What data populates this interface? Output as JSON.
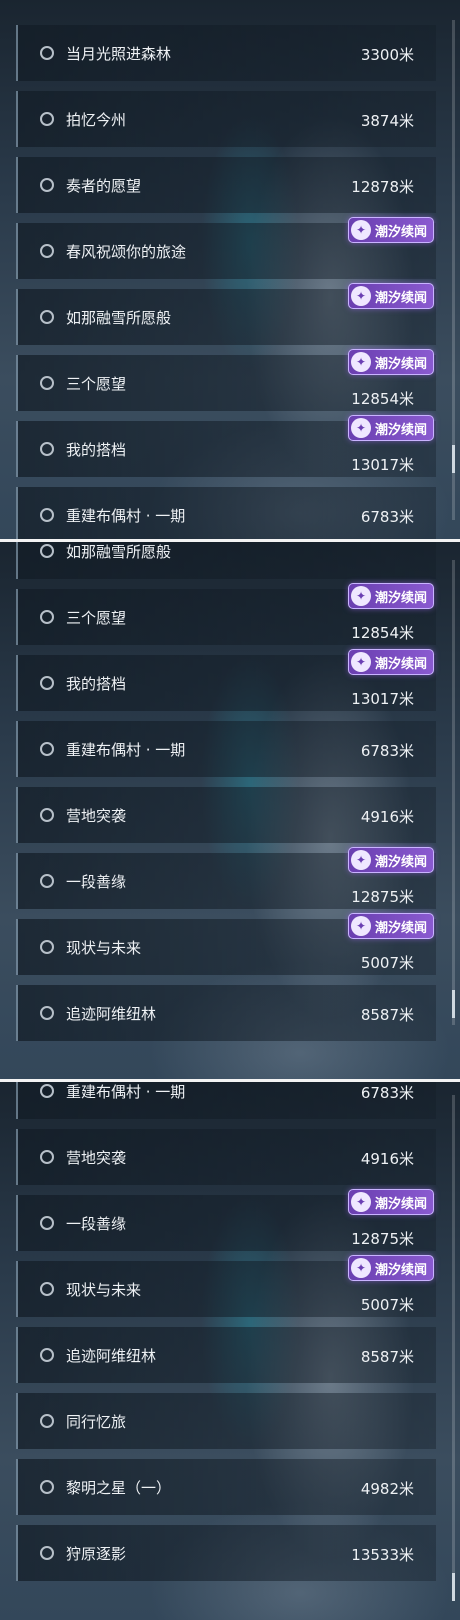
{
  "badge_label": "潮汐续闻",
  "panels": [
    {
      "items": [
        {
          "name": "当月光照进森林",
          "distance": "3300米",
          "badge": false
        },
        {
          "name": "拍忆今州",
          "distance": "3874米",
          "badge": false
        },
        {
          "name": "奏者的愿望",
          "distance": "12878米",
          "badge": false
        },
        {
          "name": "春风祝颂你的旅途",
          "distance": "",
          "badge": true
        },
        {
          "name": "如那融雪所愿般",
          "distance": "",
          "badge": true
        },
        {
          "name": "三个愿望",
          "distance": "12854米",
          "badge": true
        },
        {
          "name": "我的搭档",
          "distance": "13017米",
          "badge": true
        },
        {
          "name": "重建布偶村 · 一期",
          "distance": "6783米",
          "badge": false
        }
      ]
    },
    {
      "items": [
        {
          "name": "如那融雪所愿般",
          "distance": "",
          "badge": false
        },
        {
          "name": "三个愿望",
          "distance": "12854米",
          "badge": true
        },
        {
          "name": "我的搭档",
          "distance": "13017米",
          "badge": true
        },
        {
          "name": "重建布偶村 · 一期",
          "distance": "6783米",
          "badge": false
        },
        {
          "name": "营地突袭",
          "distance": "4916米",
          "badge": false
        },
        {
          "name": "一段善缘",
          "distance": "12875米",
          "badge": true
        },
        {
          "name": "现状与未来",
          "distance": "5007米",
          "badge": true
        },
        {
          "name": "追迹阿维纽林",
          "distance": "8587米",
          "badge": false
        }
      ]
    },
    {
      "items": [
        {
          "name": "重建布偶村 · 一期",
          "distance": "6783米",
          "badge": false
        },
        {
          "name": "营地突袭",
          "distance": "4916米",
          "badge": false
        },
        {
          "name": "一段善缘",
          "distance": "12875米",
          "badge": true
        },
        {
          "name": "现状与未来",
          "distance": "5007米",
          "badge": true
        },
        {
          "name": "追迹阿维纽林",
          "distance": "8587米",
          "badge": false
        },
        {
          "name": "同行忆旅",
          "distance": "",
          "badge": false
        },
        {
          "name": "黎明之星（一）",
          "distance": "4982米",
          "badge": false
        },
        {
          "name": "狩原逐影",
          "distance": "13533米",
          "badge": false
        }
      ]
    }
  ]
}
